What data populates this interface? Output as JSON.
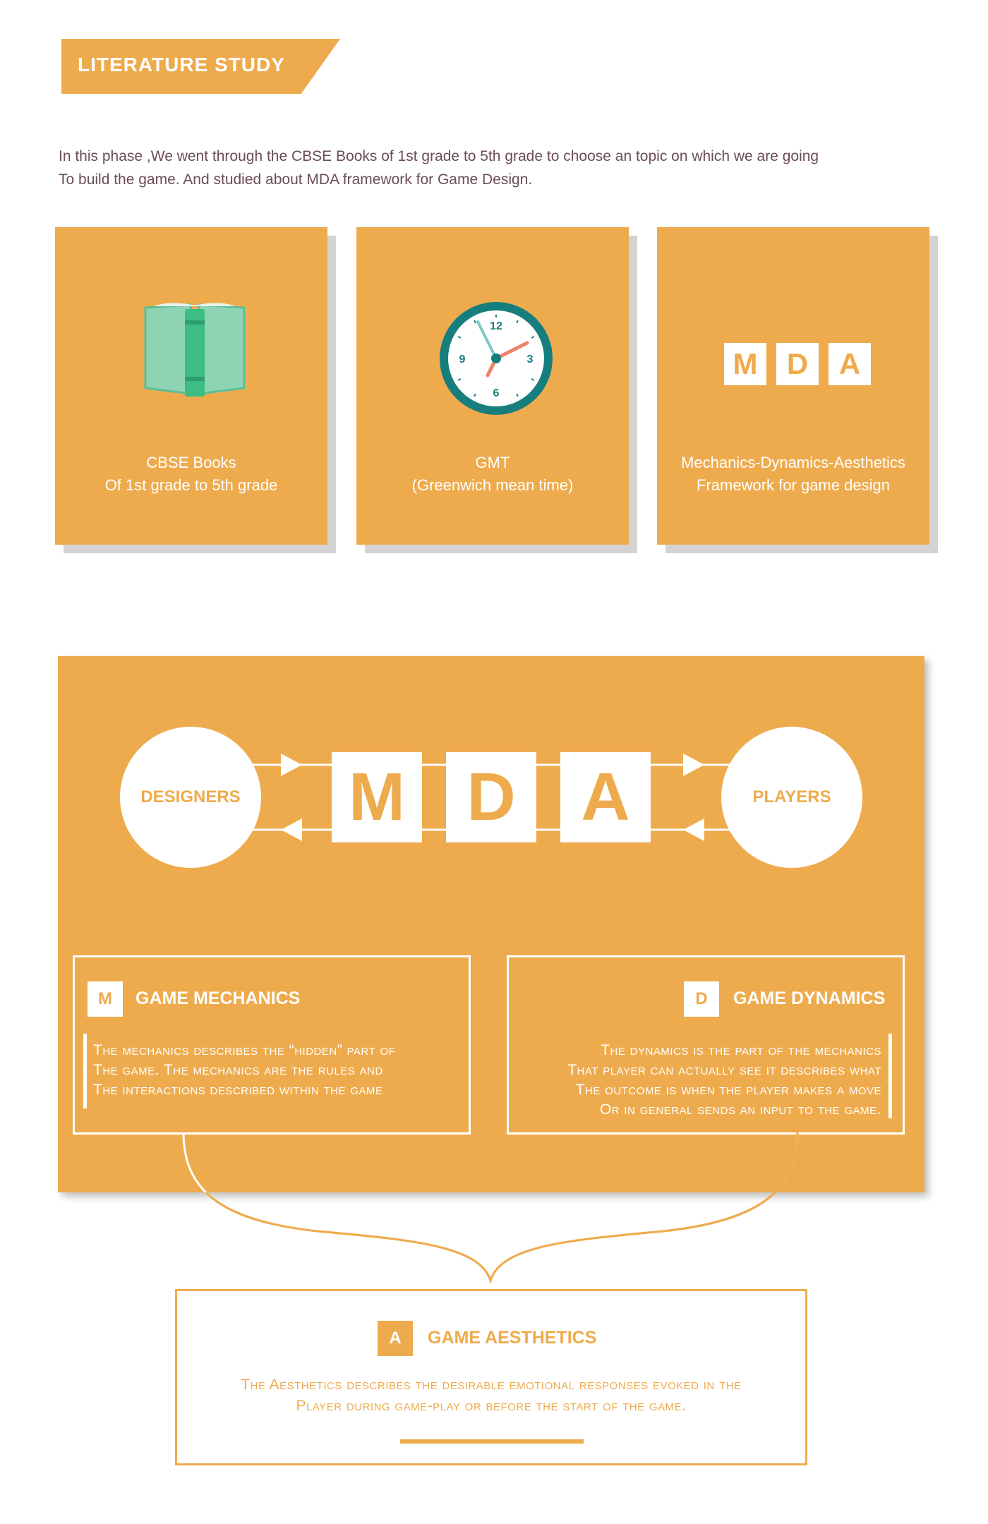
{
  "header": {
    "title": "LITERATURE  STUDY"
  },
  "intro": {
    "line1": "In this phase ,We went through the CBSE Books of 1st grade to 5th grade to choose an topic on which we are going",
    "line2": "To build the game. And studied about MDA framework for Game Design."
  },
  "cards": [
    {
      "icon": "book-icon",
      "line1": "CBSE Books",
      "line2": "Of 1st grade to 5th grade"
    },
    {
      "icon": "clock-icon",
      "line1": "GMT",
      "line2": "(Greenwich mean time)",
      "clock_numbers": {
        "twelve": "12",
        "three": "3",
        "six": "6",
        "nine": "9"
      }
    },
    {
      "icon": "mda-icon",
      "letters": [
        "M",
        "D",
        "A"
      ],
      "line1": "Mechanics-Dynamics-Aesthetics",
      "line2": "Framework for game design"
    }
  ],
  "diagram": {
    "left": "DESIGNERS",
    "right": "PLAYERS",
    "letters": [
      "M",
      "D",
      "A"
    ]
  },
  "mechanics": {
    "letter": "M",
    "title": "GAME MECHANICS",
    "lines": [
      "The mechanics describes the “hidden” part of",
      "The game. The mechanics are the rules and",
      "The interactions described within the game"
    ]
  },
  "dynamics": {
    "letter": "D",
    "title": "GAME DYNAMICS",
    "lines": [
      "The dynamics is the part of the mechanics",
      "That player can actually see it describes what",
      "The outcome is when the player makes a move",
      "Or in general sends an input to the game."
    ]
  },
  "aesthetics": {
    "letter": "A",
    "title": "GAME AESTHETICS",
    "lines": [
      "The Aesthetics describes the desirable emotional responses evoked in the",
      "Player during game-play or before the start of the game."
    ]
  },
  "colors": {
    "accent": "#EEAB4D",
    "book_green": "#8ED3B4",
    "book_spine": "#3DBD84",
    "clock_teal": "#177E7E",
    "clock_red": "#F0826A"
  }
}
